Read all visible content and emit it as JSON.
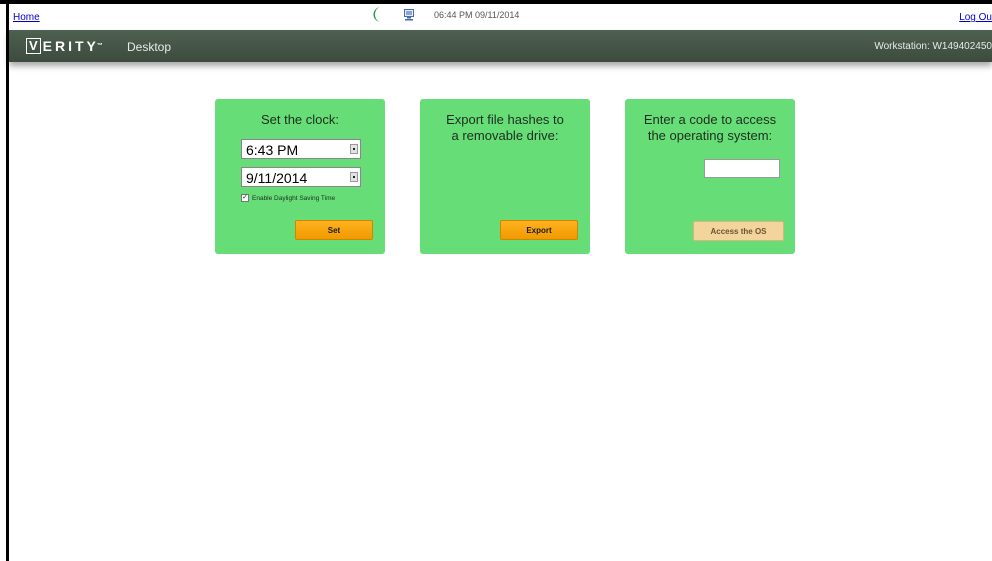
{
  "topbar": {
    "home": "Home",
    "datetime": "06:44 PM 09/11/2014",
    "logout": "Log Ou"
  },
  "brand": {
    "logo_letter": "V",
    "logo_rest": "ERITY",
    "trademark": "™",
    "app_name": "Desktop",
    "workstation": "Workstation: W149402450"
  },
  "clock": {
    "title": "Set the clock:",
    "time_value": "6:43 PM",
    "date_value": "9/11/2014",
    "dst_checked": true,
    "dst_check_glyph": "✓",
    "dst_label": "Enable Daylight Saving Time",
    "set_label": "Set"
  },
  "export": {
    "title_line1": "Export file hashes to",
    "title_line2": "a removable drive:",
    "export_label": "Export"
  },
  "access": {
    "title_line1": "Enter a code to access",
    "title_line2": "the operating system:",
    "code_value": "",
    "access_label": "Access the OS"
  },
  "colors": {
    "card_bg": "#66dd76",
    "brand_bar": "#46554a",
    "button_orange": "#f7a30c",
    "button_disabled": "#f3d49c"
  },
  "icons": {
    "moon": "moon-icon",
    "monitor": "monitor-icon"
  }
}
